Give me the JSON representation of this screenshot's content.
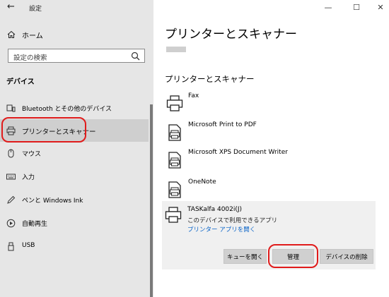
{
  "window": {
    "title": "設定",
    "back_symbol": "←",
    "minimize_symbol": "—",
    "maximize_symbol": "☐",
    "close_symbol": "✕"
  },
  "sidebar": {
    "home_label": "ホーム",
    "search_placeholder": "設定の検索",
    "section_title": "デバイス",
    "items": [
      {
        "label": "Bluetooth とその他のデバイス",
        "icon": "bluetooth-devices-icon"
      },
      {
        "label": "プリンターとスキャナー",
        "icon": "printer-icon",
        "active": true
      },
      {
        "label": "マウス",
        "icon": "mouse-icon"
      },
      {
        "label": "入力",
        "icon": "keyboard-icon"
      },
      {
        "label": "ペンと Windows Ink",
        "icon": "pen-icon"
      },
      {
        "label": "自動再生",
        "icon": "autoplay-icon"
      },
      {
        "label": "USB",
        "icon": "usb-icon"
      }
    ]
  },
  "main": {
    "page_title": "プリンターとスキャナー",
    "section_title": "プリンターとスキャナー",
    "devices": [
      {
        "name": "Fax",
        "icon": "fax-printer-icon"
      },
      {
        "name": "Microsoft Print to PDF",
        "icon": "printer-document-icon"
      },
      {
        "name": "Microsoft XPS Document Writer",
        "icon": "printer-document-icon"
      },
      {
        "name": "OneNote",
        "icon": "printer-document-icon"
      }
    ],
    "selected_device": {
      "name": "TASKalfa 4002i(J)",
      "subtitle": "このデバイスで利用できるアプリ",
      "link": "プリンター アプリを開く",
      "buttons": {
        "queue": "キューを開く",
        "manage": "管理",
        "remove": "デバイスの削除"
      }
    }
  },
  "colors": {
    "sidebar_bg": "#e6e6e6",
    "active_item_bg": "#cfcfcf",
    "highlight_oval": "#e01b1b",
    "link": "#0a64c8",
    "button_bg": "#d0d0d0"
  }
}
